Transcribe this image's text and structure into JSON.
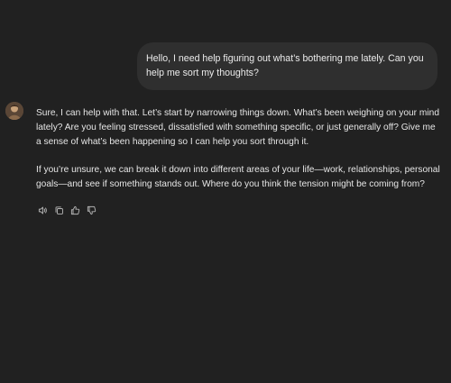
{
  "conversation": {
    "user_message": "Hello, I need help figuring out what’s bothering me lately. Can you help me sort my thoughts?",
    "assistant_paragraphs": [
      "Sure, I can help with that. Let’s start by narrowing things down. What’s been weighing on your mind lately? Are you feeling stressed, dissatisfied with something specific, or just generally off? Give me a sense of what’s been happening so I can help you sort through it.",
      "If you’re unsure, we can break it down into different areas of your life—work, relationships, personal goals—and see if something stands out. Where do you think the tension might be coming from?"
    ]
  },
  "message_actions": [
    {
      "icon": "speaker-icon"
    },
    {
      "icon": "copy-icon"
    },
    {
      "icon": "thumbs-up-icon"
    },
    {
      "icon": "thumbs-down-icon"
    }
  ],
  "colors": {
    "background": "#212121",
    "user_bubble": "#2f2f2f",
    "text": "#ececec",
    "icon": "#b4b4b4"
  }
}
